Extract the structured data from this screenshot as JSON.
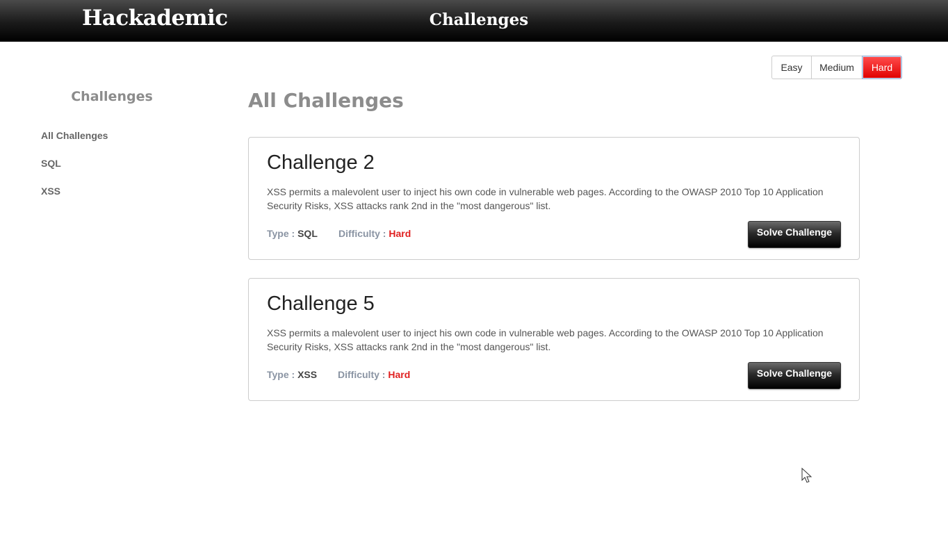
{
  "header": {
    "brand": "Hackademic",
    "title": "Challenges"
  },
  "difficulty_filter": {
    "options": [
      "Easy",
      "Medium",
      "Hard"
    ],
    "selected": "Hard"
  },
  "sidebar": {
    "heading": "Challenges",
    "items": [
      {
        "label": "All Challenges"
      },
      {
        "label": "SQL"
      },
      {
        "label": "XSS"
      }
    ]
  },
  "main": {
    "title": "All Challenges",
    "type_label": "Type :",
    "difficulty_label": "Difficulty :",
    "solve_label": "Solve Challenge",
    "challenges": [
      {
        "title": "Challenge 2",
        "description": "XSS permits a malevolent user to inject his own code in vulnerable web pages. According to the OWASP 2010 Top 10 Application Security Risks, XSS attacks rank 2nd in the \"most dangerous\" list.",
        "type": "SQL",
        "difficulty": "Hard"
      },
      {
        "title": "Challenge 5",
        "description": "XSS permits a malevolent user to inject his own code in vulnerable web pages. According to the OWASP 2010 Top 10 Application Security Risks, XSS attacks rank 2nd in the \"most dangerous\" list.",
        "type": "XSS",
        "difficulty": "Hard"
      }
    ]
  },
  "colors": {
    "hard": "#e02020",
    "header_bg": "#1a1a1a",
    "muted_heading": "#8c8c8c"
  },
  "icons": {
    "cursor": "mouse-pointer-icon"
  }
}
